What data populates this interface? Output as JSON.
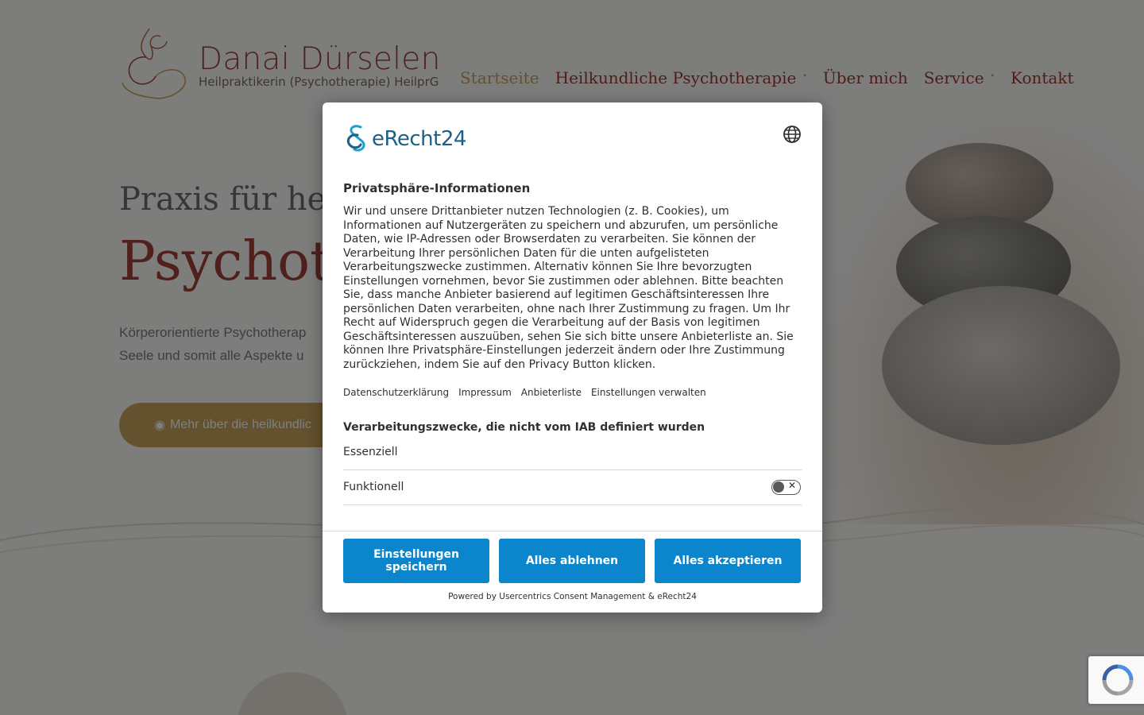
{
  "site": {
    "logo_name": "Danai Dürselen",
    "logo_sub": "Heilpraktikerin (Psychotherapie) HeilprG",
    "nav": [
      {
        "label": "Startseite"
      },
      {
        "label": "Heilkundliche Psychotherapie"
      },
      {
        "label": "Über mich"
      },
      {
        "label": "Service"
      },
      {
        "label": "Kontakt"
      }
    ],
    "hero_sub": "Praxis für hei",
    "hero_title": "Psychoth",
    "hero_text_1": "Körperorientierte Psychotherap",
    "hero_text_2": "Seele und somit alle Aspekte u",
    "hero_button": "Mehr über die heilkundlic"
  },
  "consent": {
    "brand": "eRecht24",
    "title": "Privatsphäre-Informationen",
    "body": "Wir und unsere Drittanbieter nutzen Technologien (z. B. Cookies), um Informationen auf Nutzergeräten zu speichern und abzurufen, um persönliche Daten, wie IP-Adressen oder Browserdaten zu verarbeiten. Sie können der Verarbeitung Ihrer persönlichen Daten für die unten aufgelisteten Verarbeitungszwecke zustimmen. Alternativ können Sie Ihre bevorzugten Einstellungen vornehmen, bevor Sie zustimmen oder ablehnen. Bitte beachten Sie, dass manche Anbieter basierend auf legitimen Geschäftsinteressen Ihre persönlichen Daten verarbeiten, ohne nach Ihrer Zustimmung zu fragen. Um Ihr Recht auf Widerspruch gegen die Verarbeitung auf der Basis von legitimen Geschäftsinteressen auszuüben, sehen Sie sich bitte unsere Anbieterliste an. Sie können Ihre Privatsphäre-Einstellungen jederzeit ändern oder Ihre Zustimmung zurückziehen, indem Sie auf den Privacy Button klicken.",
    "links": [
      "Datenschutzerklärung",
      "Impressum",
      "Anbieterliste",
      "Einstellungen verwalten"
    ],
    "section_title": "Verarbeitungszwecke, die nicht vom IAB definiert wurden",
    "purposes": [
      {
        "label": "Essenziell"
      },
      {
        "label": "Funktionell",
        "enabled": false
      }
    ],
    "buttons": {
      "save": "Einstellungen speichern",
      "deny": "Alles ablehnen",
      "accept": "Alles akzeptieren"
    },
    "powered_by": "Powered by Usercentrics Consent Management & eRecht24",
    "accent_color": "#0b85cb"
  }
}
